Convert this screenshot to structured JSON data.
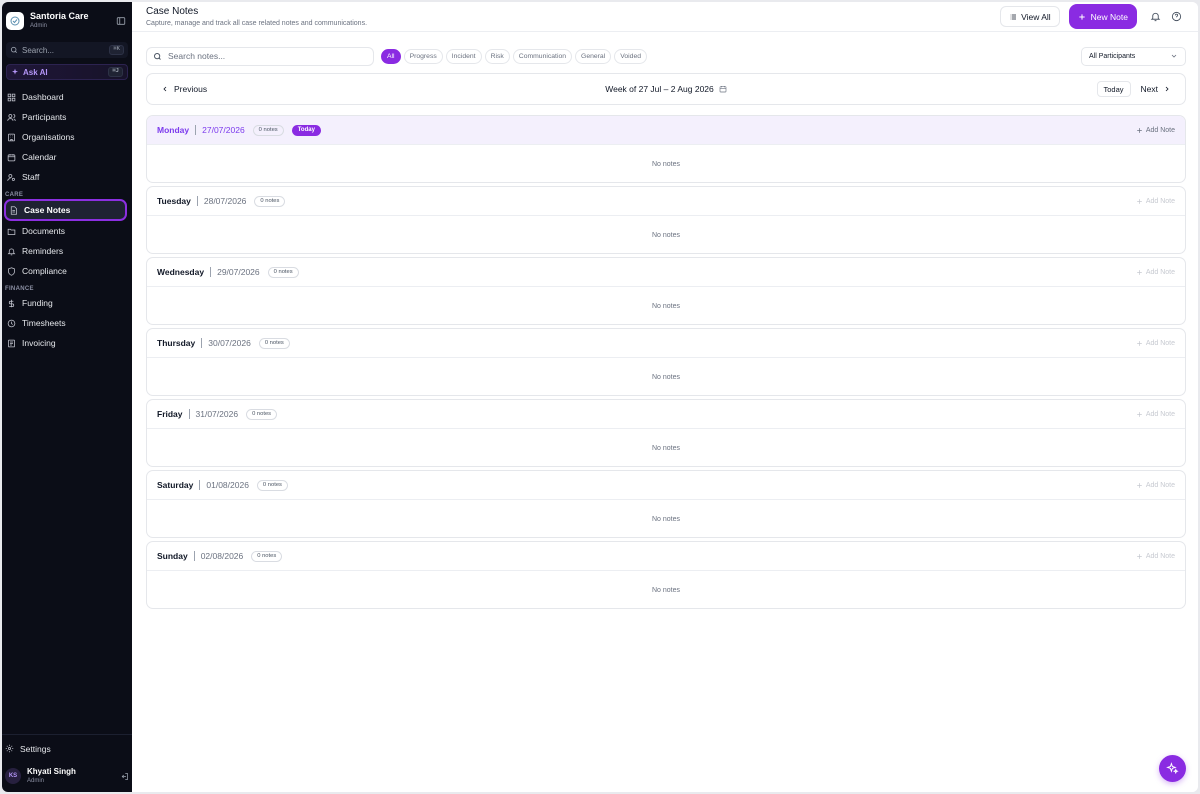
{
  "brand": {
    "name": "Santoria Care",
    "role": "Admin"
  },
  "sidebar": {
    "search": {
      "label": "Search...",
      "shortcut": "⌘K"
    },
    "ask_ai": {
      "label": "Ask AI",
      "shortcut": "⌘J"
    },
    "main_items": [
      {
        "label": "Dashboard",
        "icon": "dashboard-icon"
      },
      {
        "label": "Participants",
        "icon": "users-icon"
      },
      {
        "label": "Organisations",
        "icon": "building-icon"
      },
      {
        "label": "Calendar",
        "icon": "calendar-icon"
      },
      {
        "label": "Staff",
        "icon": "staff-icon"
      }
    ],
    "care_label": "CARE",
    "care_items": [
      {
        "label": "Case Notes",
        "icon": "note-icon",
        "active": true
      },
      {
        "label": "Documents",
        "icon": "folder-icon"
      },
      {
        "label": "Reminders",
        "icon": "bell-icon"
      },
      {
        "label": "Compliance",
        "icon": "shield-icon"
      }
    ],
    "finance_label": "FINANCE",
    "finance_items": [
      {
        "label": "Funding",
        "icon": "dollar-icon"
      },
      {
        "label": "Timesheets",
        "icon": "clock-icon"
      },
      {
        "label": "Invoicing",
        "icon": "invoice-icon"
      }
    ],
    "settings_label": "Settings",
    "user": {
      "initials": "KS",
      "name": "Khyati Singh",
      "role": "Admin"
    }
  },
  "header": {
    "title": "Case Notes",
    "subtitle": "Capture, manage and track all case related notes and communications.",
    "view_all_label": "View All",
    "new_note_label": "New Note"
  },
  "filters": {
    "search_placeholder": "Search notes...",
    "chips": [
      "All",
      "Progress",
      "Incident",
      "Risk",
      "Communication",
      "General",
      "Voided"
    ],
    "active_chip": "All",
    "participants_select": "All Participants"
  },
  "week_nav": {
    "previous_label": "Previous",
    "week_label": "Week of 27 Jul – 2 Aug 2026",
    "today_label": "Today",
    "next_label": "Next"
  },
  "days": [
    {
      "name": "Monday",
      "date": "27/07/2026",
      "count": "0 notes",
      "is_today": true,
      "today_label": "Today",
      "add_label": "Add Note",
      "empty_label": "No notes"
    },
    {
      "name": "Tuesday",
      "date": "28/07/2026",
      "count": "0 notes",
      "is_today": false,
      "add_label": "Add Note",
      "empty_label": "No notes"
    },
    {
      "name": "Wednesday",
      "date": "29/07/2026",
      "count": "0 notes",
      "is_today": false,
      "add_label": "Add Note",
      "empty_label": "No notes"
    },
    {
      "name": "Thursday",
      "date": "30/07/2026",
      "count": "0 notes",
      "is_today": false,
      "add_label": "Add Note",
      "empty_label": "No notes"
    },
    {
      "name": "Friday",
      "date": "31/07/2026",
      "count": "0 notes",
      "is_today": false,
      "add_label": "Add Note",
      "empty_label": "No notes"
    },
    {
      "name": "Saturday",
      "date": "01/08/2026",
      "count": "0 notes",
      "is_today": false,
      "add_label": "Add Note",
      "empty_label": "No notes"
    },
    {
      "name": "Sunday",
      "date": "02/08/2026",
      "count": "0 notes",
      "is_today": false,
      "add_label": "Add Note",
      "empty_label": "No notes"
    }
  ],
  "colors": {
    "accent": "#8a2be2",
    "sidebar_bg": "#0b0d17",
    "today_bg": "#f4f0fd"
  }
}
